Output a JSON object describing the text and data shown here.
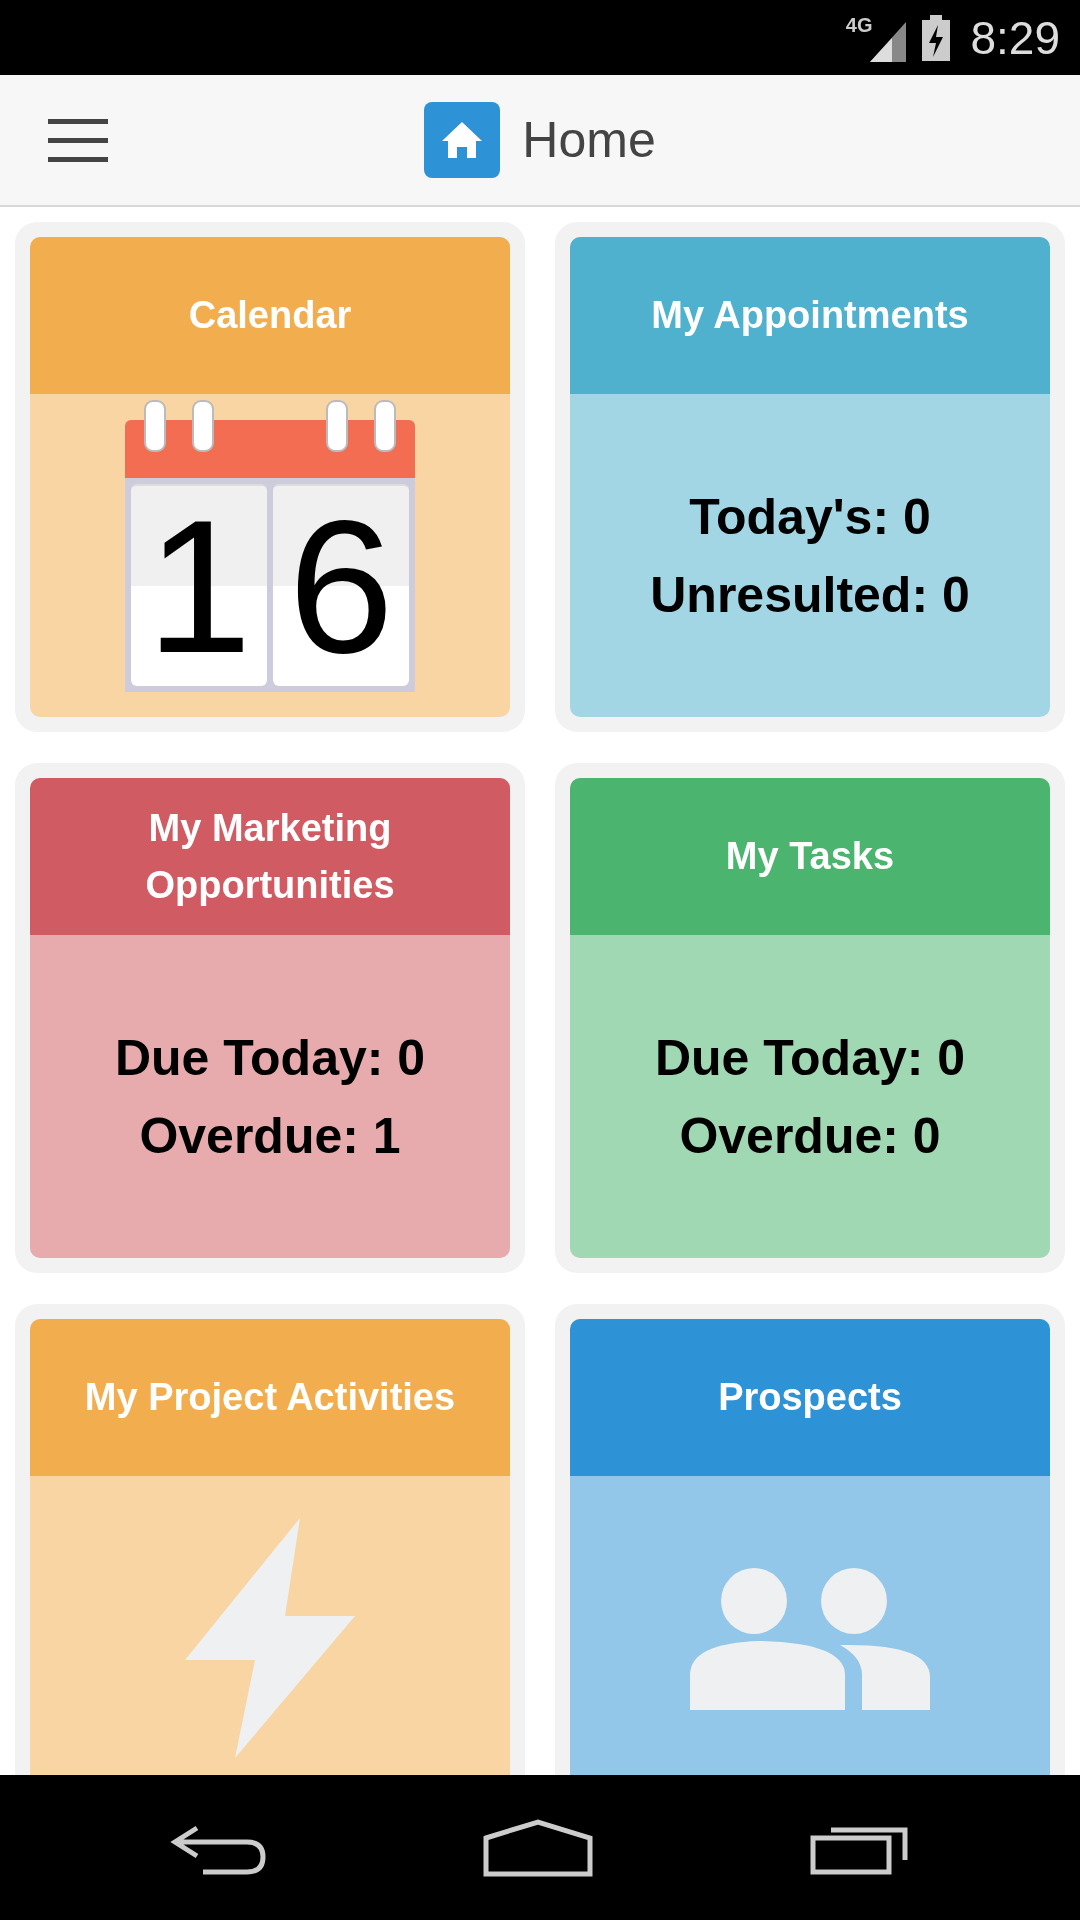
{
  "status_bar": {
    "network": "4G",
    "time": "8:29"
  },
  "app_bar": {
    "title": "Home"
  },
  "tiles": [
    {
      "kind": "calendar",
      "title": "Calendar",
      "color": "#f2ae4e",
      "date": "16"
    },
    {
      "kind": "stats",
      "title": "My Appointments",
      "color": "#4fb1cd",
      "lines": [
        "Today's: 0",
        "Unresulted: 0"
      ]
    },
    {
      "kind": "stats",
      "title": "My Marketing Opportunities",
      "color": "#d05b62",
      "lines": [
        "Due Today: 0",
        "Overdue: 1"
      ]
    },
    {
      "kind": "stats",
      "title": "My Tasks",
      "color": "#4bb46e",
      "lines": [
        "Due Today: 0",
        "Overdue: 0"
      ]
    },
    {
      "kind": "activity",
      "title": "My Project Activities",
      "color": "#f2ae4e"
    },
    {
      "kind": "people",
      "title": "Prospects",
      "color": "#2d93d6"
    }
  ]
}
